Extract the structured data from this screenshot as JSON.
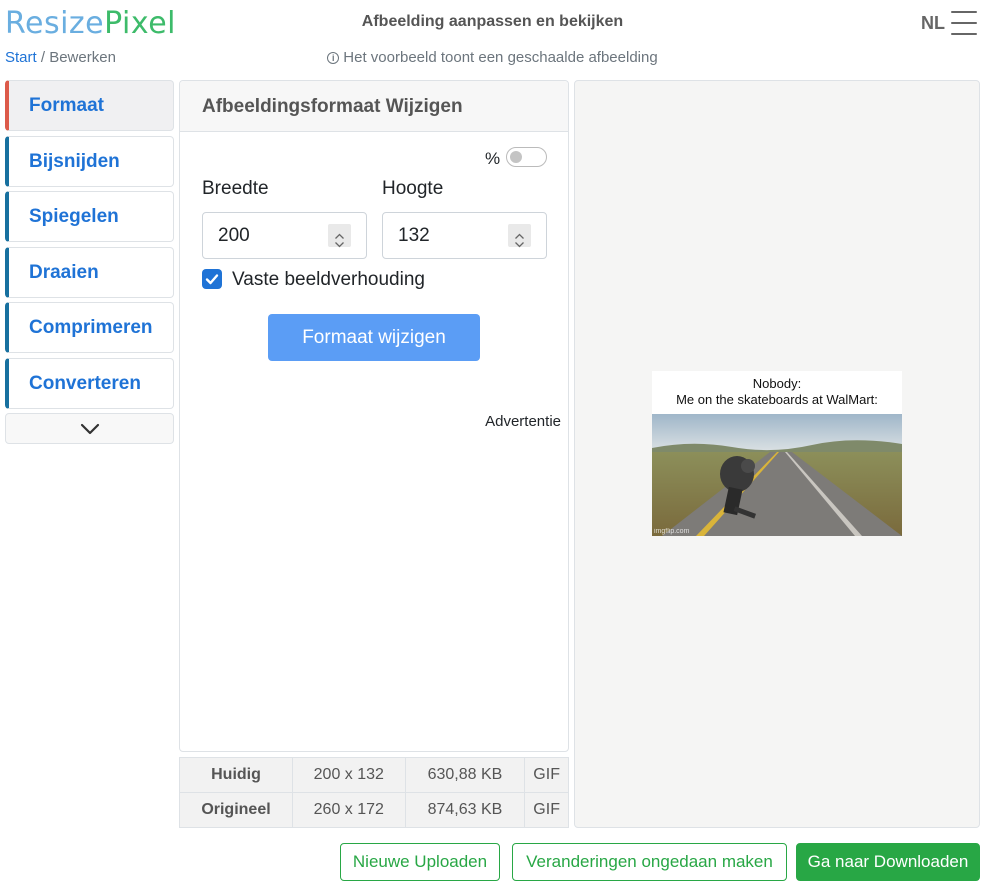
{
  "header": {
    "logo_part1": "Resize",
    "logo_part2": "Pixel",
    "title": "Afbeelding aanpassen en bekijken",
    "language": "NL",
    "menu_icon": "hamburger-menu-icon"
  },
  "breadcrumb": {
    "home": "Start",
    "separator": " / ",
    "current": "Bewerken"
  },
  "notice": {
    "icon": "info-icon",
    "text": "Het voorbeeld toont een geschaalde afbeelding"
  },
  "sidebar": {
    "items": [
      {
        "label": "Formaat",
        "active": true
      },
      {
        "label": "Bijsnijden",
        "active": false
      },
      {
        "label": "Spiegelen",
        "active": false
      },
      {
        "label": "Draaien",
        "active": false
      },
      {
        "label": "Comprimeren",
        "active": false
      },
      {
        "label": "Converteren",
        "active": false
      }
    ],
    "more_icon": "chevron-down-icon"
  },
  "form": {
    "title": "Afbeeldingsformaat Wijzigen",
    "percent_label": "%",
    "percent_toggle_on": false,
    "width_label": "Breedte",
    "width_value": "200",
    "height_label": "Hoogte",
    "height_value": "132",
    "aspect_label": "Vaste beeldverhouding",
    "aspect_checked": true,
    "submit_label": "Formaat wijzigen",
    "ad_label": "Advertentie"
  },
  "info_table": {
    "rows": [
      {
        "label": "Huidig",
        "dimensions": "200 x 132",
        "size": "630,88 KB",
        "format": "GIF"
      },
      {
        "label": "Origineel",
        "dimensions": "260 x 172",
        "size": "874,63 KB",
        "format": "GIF"
      }
    ]
  },
  "preview": {
    "caption_line1": "Nobody:",
    "caption_line2": "Me on the skateboards at WalMart:",
    "watermark": "imgflip.com"
  },
  "actions": {
    "upload_new": "Nieuwe Uploaden",
    "undo_changes": "Veranderingen ongedaan maken",
    "go_download": "Ga naar Downloaden"
  },
  "colors": {
    "link_blue": "#1f73d6",
    "active_accent": "#dc5a4a",
    "sidebar_accent": "#17709f",
    "primary_button": "#5b9df5",
    "success_green": "#28a745"
  }
}
